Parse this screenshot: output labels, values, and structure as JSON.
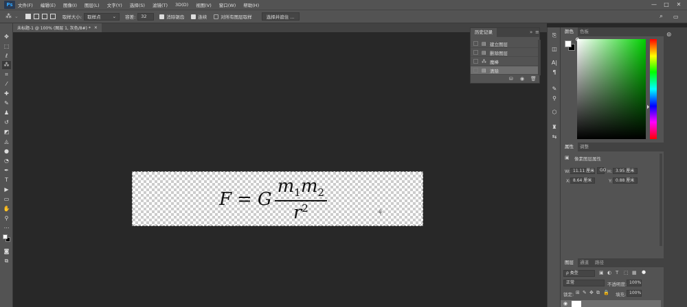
{
  "app": {
    "logo": "Ps"
  },
  "menu": [
    "文件(F)",
    "编辑(E)",
    "图像(I)",
    "图层(L)",
    "文字(Y)",
    "选择(S)",
    "滤镜(T)",
    "3D(D)",
    "视图(V)",
    "窗口(W)",
    "帮助(H)"
  ],
  "window_controls": {
    "minimize": "—",
    "maximize": "□",
    "close": "✕"
  },
  "options": {
    "sample_size_label": "取样大小:",
    "sample_size_value": "取样点",
    "tolerance_label": "容差:",
    "tolerance_value": "32",
    "antialias_label": "消除锯齿",
    "antialias_checked": true,
    "contiguous_label": "连续",
    "contiguous_checked": true,
    "all_layers_label": "对所有图层取样",
    "all_layers_checked": false,
    "select_subject_button": "选择并遮住 ..."
  },
  "document": {
    "tab_title": "未标题-1 @ 100% (图层 1, 灰色/8#) *"
  },
  "formula": {
    "F": "F",
    "eq": "=",
    "G": "G",
    "m1": "m",
    "sub1": "1",
    "m2": "m",
    "sub2": "2",
    "r": "r",
    "sup": "2"
  },
  "history": {
    "tab_label": "历史记录",
    "items": [
      {
        "label": "建立图层",
        "selected": false
      },
      {
        "label": "删除图层",
        "selected": false
      },
      {
        "label": "魔棒",
        "selected": false
      },
      {
        "label": "清除",
        "selected": true
      }
    ]
  },
  "color_panel": {
    "tabs": [
      "颜色",
      "色板"
    ]
  },
  "properties_panel": {
    "tabs": [
      "属性",
      "调整"
    ],
    "section_title": "像素图层属性",
    "w_label": "W:",
    "w_value": "11.11 厘米",
    "link_label": "GO",
    "h_label": "H:",
    "h_value": "3.95 厘米",
    "x_label": "X:",
    "x_value": "8.64 厘米",
    "y_label": "Y:",
    "y_value": "0.88 厘米"
  },
  "layers_panel": {
    "tabs": [
      "图层",
      "通道",
      "路径"
    ],
    "filter_value": "ρ 类型",
    "blend_mode": "正常",
    "opacity_label": "不透明度:",
    "opacity_value": "100%",
    "lock_label": "锁定:",
    "fill_label": "填充:",
    "fill_value": "100%"
  }
}
